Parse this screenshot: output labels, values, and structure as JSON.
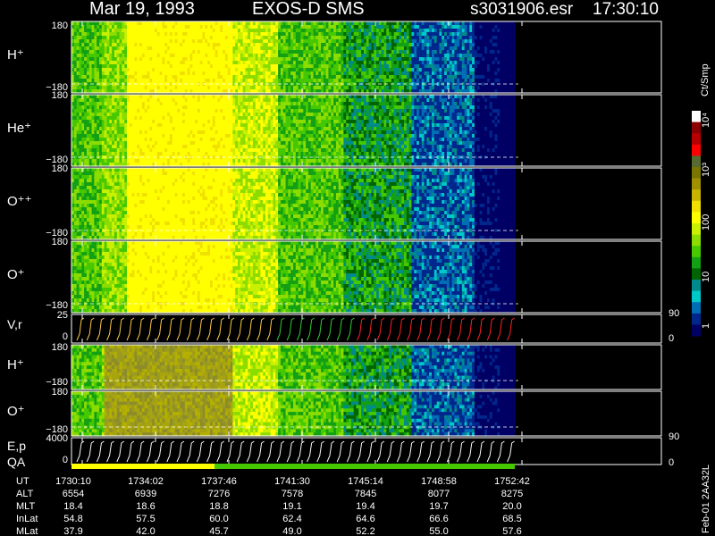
{
  "header": {
    "date": "Mar 19, 1993",
    "instrument": "EXOS-D SMS",
    "file": "s3031906.esr",
    "time": "17:30:10"
  },
  "colorbar": {
    "unit": "Ct/Smp",
    "tick_labels": [
      "10⁴",
      "10³",
      "100",
      "10",
      "1"
    ],
    "colors": [
      "#ffffff",
      "#8b0000",
      "#b80000",
      "#ff0000",
      "#556b2f",
      "#7a7400",
      "#a09000",
      "#c8b400",
      "#f0e000",
      "#ffff00",
      "#c8f000",
      "#8cdc00",
      "#48c800",
      "#14a014",
      "#006400",
      "#008b8b",
      "#00c8c8",
      "#006eb4",
      "#00288c",
      "#000064"
    ]
  },
  "chart_data": {
    "type": "heatmap",
    "panels": [
      {
        "name": "H⁺",
        "ymax": "180",
        "ymin": "−180"
      },
      {
        "name": "He⁺",
        "ymax": "180",
        "ymin": "−180"
      },
      {
        "name": "O⁺⁺",
        "ymax": "180",
        "ymin": "−180"
      },
      {
        "name": "O⁺",
        "ymax": "180",
        "ymin": "−180"
      },
      {
        "name": "V,r",
        "ymax": "25",
        "ymin": "0",
        "right_max": "90",
        "right_min": "0"
      },
      {
        "name": "H⁺",
        "ymax": "180",
        "ymin": "−180"
      },
      {
        "name": "O⁺",
        "ymax": "180",
        "ymin": "−180"
      },
      {
        "name": "E,p",
        "ymax": "4000",
        "ymin": "0",
        "right_max": "90",
        "right_min": "0"
      }
    ],
    "qa_label": "QA",
    "ephemeris": {
      "rows": [
        {
          "label": "UT",
          "values": [
            "1730:10",
            "1734:02",
            "1737:46",
            "1741:30",
            "1745:14",
            "1748:58",
            "1752:42"
          ]
        },
        {
          "label": "ALT",
          "values": [
            "6554",
            "6939",
            "7276",
            "7578",
            "7845",
            "8077",
            "8275"
          ]
        },
        {
          "label": "MLT",
          "values": [
            "18.4",
            "18.6",
            "18.8",
            "19.1",
            "19.4",
            "19.7",
            "20.0"
          ]
        },
        {
          "label": "InLat",
          "values": [
            "54.8",
            "57.5",
            "60.0",
            "62.4",
            "64.6",
            "66.6",
            "68.5"
          ]
        },
        {
          "label": "MLat",
          "values": [
            "37.9",
            "42.0",
            "45.7",
            "49.0",
            "52.2",
            "55.0",
            "57.6"
          ]
        }
      ]
    }
  },
  "footer": {
    "id_text": "Feb-01 2AA32L"
  }
}
